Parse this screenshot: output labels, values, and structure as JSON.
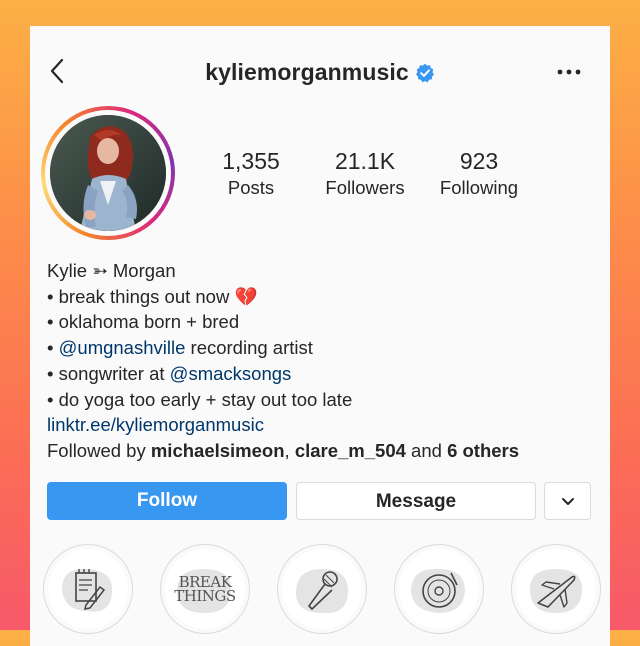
{
  "header": {
    "username": "kyliemorganmusic",
    "back_icon": "chevron-left-icon",
    "verified_icon": "verified-badge-icon",
    "more_icon": "more-horizontal-icon"
  },
  "profile": {
    "avatar_alt": "profile-photo",
    "ring_colors": [
      "#f58529",
      "#feda77",
      "#dd2a7b",
      "#8134af"
    ]
  },
  "stats": [
    {
      "value": "1,355",
      "label": "Posts"
    },
    {
      "value": "21.1K",
      "label": "Followers"
    },
    {
      "value": "923",
      "label": "Following"
    }
  ],
  "bio": {
    "name": "Kylie ➳ Morgan",
    "lines": [
      "• break things out now 💔",
      "• oklahoma born + bred",
      "• @umgnashville recording artist",
      "• songwriter at @smacksongs",
      "• do yoga too early + stay out too late"
    ],
    "mentions": [
      "@umgnashville",
      "@smacksongs"
    ],
    "link": "linktr.ee/kyliemorganmusic",
    "followed_by_prefix": "Followed by ",
    "followed_by_users": [
      "michaelsimeon",
      "clare_m_504"
    ],
    "followed_by_and": " and ",
    "followed_by_others": "6 others"
  },
  "actions": {
    "follow_label": "Follow",
    "message_label": "Message",
    "dropdown_icon": "chevron-down-icon",
    "follow_color": "#3897f0"
  },
  "highlights": [
    {
      "icon": "notepad-pencil-icon"
    },
    {
      "icon": "break-things-text-icon",
      "text": "BREAK THINGS"
    },
    {
      "icon": "microphone-icon"
    },
    {
      "icon": "vinyl-record-icon"
    },
    {
      "icon": "airplane-icon"
    }
  ]
}
